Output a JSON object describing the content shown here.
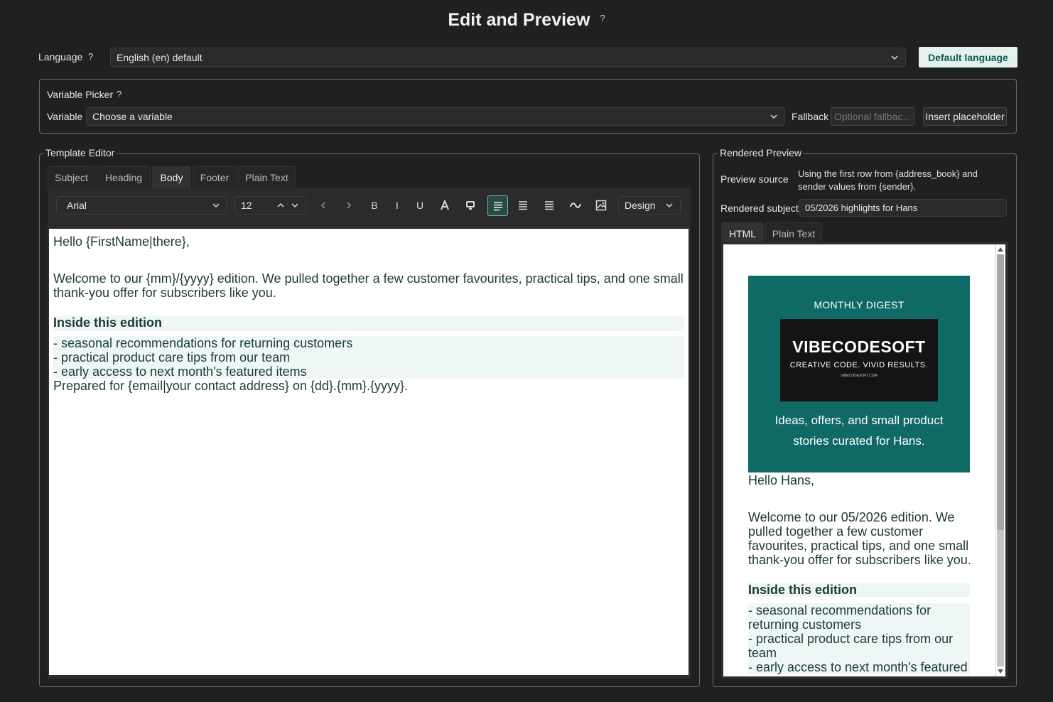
{
  "page": {
    "title": "Edit and Preview",
    "help": "?"
  },
  "language": {
    "label": "Language",
    "help": "?",
    "selected": "English (en)  default",
    "default_button": "Default language"
  },
  "variable_picker": {
    "legend": "Variable Picker",
    "help": "?",
    "variable_label": "Variable",
    "variable_selected": "Choose a variable",
    "fallback_label": "Fallback",
    "fallback_placeholder": "Optional fallbac...",
    "insert_button": "Insert placeholder"
  },
  "template_editor": {
    "legend": "Template Editor",
    "tabs": [
      "Subject",
      "Heading",
      "Body",
      "Footer",
      "Plain Text"
    ],
    "active_tab": "Body",
    "toolbar": {
      "font": "Arial",
      "size": "12",
      "bold": "B",
      "italic": "I",
      "underline": "U",
      "mode": "Design",
      "icons": [
        "chevron-left-icon",
        "chevron-right-icon",
        "bold-icon",
        "italic-icon",
        "underline-icon",
        "text-color-icon",
        "highlight-icon",
        "align-left-icon",
        "align-center-icon",
        "align-right-icon",
        "link-icon",
        "image-icon"
      ]
    },
    "body": {
      "greeting": "Hello {FirstName|there},",
      "intro_1": "Welcome to our {mm}/{yyyy} edition. We pulled together a few customer favourites, practical tips, and one small",
      "intro_2": "thank-you offer for subscribers like you.",
      "heading": "Inside this edition",
      "list": [
        "- seasonal recommendations for returning customers",
        "- practical product care tips from our team",
        "- early access to next month's featured items"
      ],
      "prepared": "Prepared for {email|your contact address} on {dd}.{mm}.{yyyy}."
    }
  },
  "rendered_preview": {
    "legend": "Rendered Preview",
    "source_label": "Preview source",
    "source_line_1": "Using the first row from {address_book} and",
    "source_line_2": "sender values from {sender}.",
    "subject_label": "Rendered subject",
    "subject_value": "05/2026 highlights for Hans",
    "tabs": [
      "HTML",
      "Plain Text"
    ],
    "active_tab": "HTML",
    "email": {
      "banner_kicker": "MONTHLY DIGEST",
      "logo_main": "VIBECODESOFT",
      "logo_tagline": "CREATIVE CODE. VIVID RESULTS.",
      "logo_url": "VIBECODESOFT.COM",
      "banner_line_1": "Ideas, offers, and small product",
      "banner_line_2": "stories curated for Hans.",
      "greeting": "Hello Hans,",
      "intro_lines": [
        "Welcome to our 05/2026 edition. We",
        "pulled together a few customer",
        "favourites, practical tips, and one small",
        "thank-you offer for subscribers like you."
      ],
      "heading": "Inside this edition",
      "list_lines": [
        "- seasonal recommendations for",
        "returning customers",
        "- practical product care tips from our",
        "team",
        "- early access to next month's featured"
      ]
    }
  },
  "colors": {
    "background": "#202020",
    "accent_teal": "#0f6a66",
    "button_light": "#e4f1ee",
    "text_dark_teal": "#1c3a38"
  }
}
